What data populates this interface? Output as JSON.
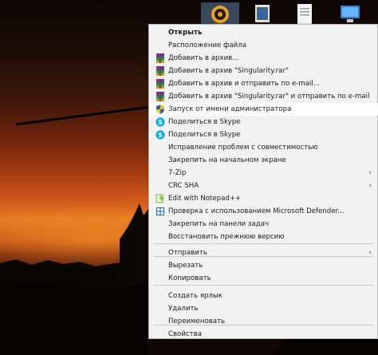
{
  "menu": {
    "items": [
      {
        "label": "Открыть",
        "icon": "",
        "bold": true
      },
      {
        "label": "Расположение файла",
        "icon": ""
      },
      {
        "label": "Добавить в архив...",
        "icon": "winrar-icon"
      },
      {
        "label": "Добавить в архив \"Singularity.rar\"",
        "icon": "winrar-icon"
      },
      {
        "label": "Добавить в архив и отправить по e-mail...",
        "icon": "winrar-icon"
      },
      {
        "label": "Добавить в архив \"Singularity.rar\" и отправить по e-mail",
        "icon": "winrar-icon"
      },
      {
        "label": "Запуск от имени администратора",
        "icon": "uac-shield-icon"
      },
      {
        "label": "Поделиться в Skype",
        "icon": "skype-icon"
      },
      {
        "label": "Поделиться в Skype",
        "icon": "skype-icon"
      },
      {
        "label": "Исправление проблем с совместимостью",
        "icon": ""
      },
      {
        "label": "Закрепить на начальном экране",
        "icon": ""
      },
      {
        "label": "7-Zip",
        "icon": "",
        "submenu": true
      },
      {
        "label": "CRC SHA",
        "icon": "",
        "submenu": true
      },
      {
        "label": "Edit with Notepad++",
        "icon": "notepadpp-icon"
      },
      {
        "label": "Проверка с использованием Microsoft Defender...",
        "icon": "defender-icon"
      },
      {
        "label": "Закрепить на панели задач",
        "icon": ""
      },
      {
        "label": "Восстановить прежнюю версию",
        "icon": ""
      },
      {
        "label": "Отправить",
        "icon": "",
        "submenu": true
      },
      {
        "label": "Вырезать",
        "icon": ""
      },
      {
        "label": "Копировать",
        "icon": ""
      },
      {
        "label": "Создать ярлык",
        "icon": ""
      },
      {
        "label": "Удалить",
        "icon": ""
      },
      {
        "label": "Переименовать",
        "icon": ""
      },
      {
        "label": "Свойства",
        "icon": ""
      }
    ],
    "submenu_glyph": "›"
  },
  "colors": {
    "menu_bg": "#f2f2f2",
    "menu_text": "#1a1a1a",
    "separator": "#c9c9c9",
    "skype": "#00aff0",
    "winrar_a": "#8e2a8e",
    "winrar_b": "#2a63b5"
  }
}
